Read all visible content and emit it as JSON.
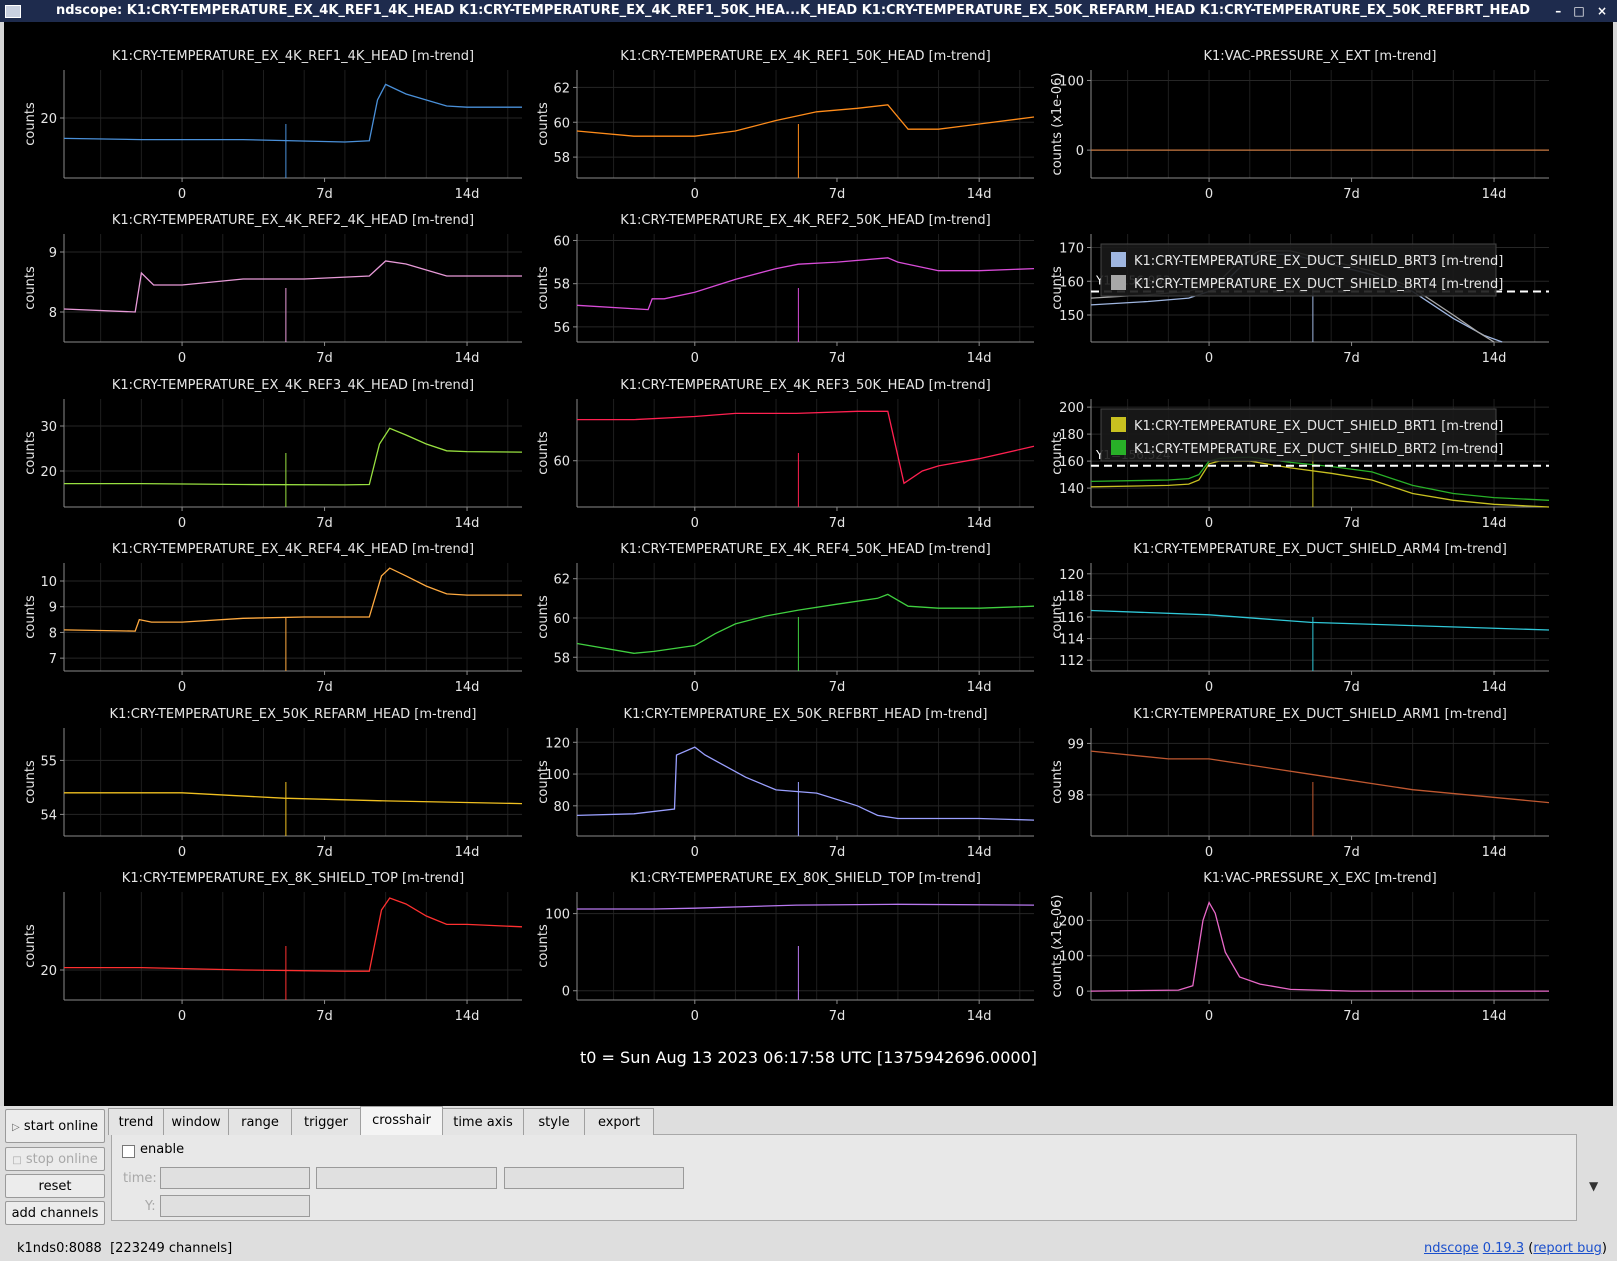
{
  "window": {
    "title": "ndscope: K1:CRY-TEMPERATURE_EX_4K_REF1_4K_HEAD K1:CRY-TEMPERATURE_EX_4K_REF1_50K_HEA...K_HEAD K1:CRY-TEMPERATURE_EX_50K_REFARM_HEAD K1:CRY-TEMPERATURE_EX_50K_REFBRT_HEAD",
    "buttons": "– □ ×"
  },
  "t0_label": "t0 = Sun Aug 13 2023 06:17:58 UTC [1375942696.0000]",
  "chart_data": [
    {
      "type": "line",
      "title": "K1:CRY-TEMPERATURE_EX_4K_REF1_4K_HEAD [m-trend]",
      "ylabel": "counts",
      "color": "#4a90d9",
      "yticks": [
        20
      ],
      "ylim": [
        15,
        24
      ],
      "xticks": [
        0,
        7,
        14
      ],
      "xticklabels": [
        "0",
        "7d",
        "14d"
      ],
      "xlim": [
        -5.8,
        16.7
      ],
      "cursor_x": 5.1,
      "series": [
        {
          "x": [
            -5.8,
            -2,
            3,
            8,
            9.2,
            9.6,
            10,
            11,
            12,
            13,
            14,
            16.7
          ],
          "y": [
            18.3,
            18.2,
            18.2,
            18.0,
            18.1,
            21.5,
            22.8,
            22.0,
            21.5,
            21.0,
            20.9,
            20.9
          ]
        }
      ]
    },
    {
      "type": "line",
      "title": "K1:CRY-TEMPERATURE_EX_4K_REF1_50K_HEAD [m-trend]",
      "ylabel": "counts",
      "color": "#ff8c1a",
      "yticks": [
        58,
        60,
        62
      ],
      "ylim": [
        56.8,
        63
      ],
      "xticks": [
        0,
        7,
        14
      ],
      "xticklabels": [
        "0",
        "7d",
        "14d"
      ],
      "xlim": [
        -5.8,
        16.7
      ],
      "cursor_x": 5.1,
      "series": [
        {
          "x": [
            -5.8,
            -3,
            0,
            2,
            4,
            6,
            8,
            9.5,
            10.5,
            12,
            14,
            16.7
          ],
          "y": [
            59.5,
            59.2,
            59.2,
            59.5,
            60.1,
            60.6,
            60.8,
            61.0,
            59.6,
            59.6,
            59.9,
            60.3
          ]
        }
      ]
    },
    {
      "type": "line",
      "title": "K1:VAC-PRESSURE_X_EXT [m-trend]",
      "ylabel": "counts (x1e-06)",
      "color": "#c87840",
      "yticks": [
        0,
        100
      ],
      "ylim": [
        -40,
        115
      ],
      "xticks": [
        0,
        7,
        14
      ],
      "xticklabels": [
        "0",
        "7d",
        "14d"
      ],
      "xlim": [
        -5.8,
        16.7
      ],
      "cursor_x": null,
      "series": [
        {
          "x": [
            -5.8,
            16.7
          ],
          "y": [
            0,
            0
          ]
        }
      ]
    },
    {
      "type": "line",
      "title": "K1:CRY-TEMPERATURE_EX_4K_REF2_4K_HEAD [m-trend]",
      "ylabel": "counts",
      "color": "#e89ad8",
      "yticks": [
        8,
        9
      ],
      "ylim": [
        7.5,
        9.3
      ],
      "xticks": [
        0,
        7,
        14
      ],
      "xticklabels": [
        "0",
        "7d",
        "14d"
      ],
      "xlim": [
        -5.8,
        16.7
      ],
      "cursor_x": 5.1,
      "series": [
        {
          "x": [
            -5.8,
            -2.3,
            -2.0,
            -1.4,
            0,
            3,
            6,
            9.2,
            10,
            11,
            12,
            13,
            14,
            16.7
          ],
          "y": [
            8.05,
            8.0,
            8.65,
            8.45,
            8.45,
            8.55,
            8.55,
            8.6,
            8.85,
            8.8,
            8.7,
            8.6,
            8.6,
            8.6
          ]
        }
      ]
    },
    {
      "type": "line",
      "title": "K1:CRY-TEMPERATURE_EX_4K_REF2_50K_HEAD [m-trend]",
      "ylabel": "counts",
      "color": "#d84cd8",
      "yticks": [
        56,
        58,
        60
      ],
      "ylim": [
        55.3,
        60.3
      ],
      "xticks": [
        0,
        7,
        14
      ],
      "xticklabels": [
        "0",
        "7d",
        "14d"
      ],
      "xlim": [
        -5.8,
        16.7
      ],
      "cursor_x": 5.1,
      "series": [
        {
          "x": [
            -5.8,
            -2.3,
            -2.1,
            -1.5,
            0,
            2,
            4,
            5.1,
            7,
            9.5,
            10,
            12,
            14,
            16.7
          ],
          "y": [
            57.0,
            56.8,
            57.3,
            57.3,
            57.6,
            58.2,
            58.7,
            58.9,
            59.0,
            59.2,
            59.0,
            58.6,
            58.6,
            58.7
          ]
        }
      ]
    },
    {
      "type": "line",
      "title": "",
      "ylabel": "counts",
      "color": "#9fb6e0",
      "yticks": [
        150,
        160,
        170
      ],
      "ylim": [
        142,
        174
      ],
      "xticks": [
        0,
        7,
        14
      ],
      "xticklabels": [
        "0",
        "7d",
        "14d"
      ],
      "xlim": [
        -5.8,
        16.7
      ],
      "cursor_x": 5.1,
      "hline": 156.953,
      "hline_label": "Y1=156.953",
      "legend_placement": "top",
      "series": [
        {
          "name": "K1:CRY-TEMPERATURE_EX_DUCT_SHIELD_BRT3 [m-trend]",
          "color": "#9fb6e0",
          "x": [
            -5.8,
            -3,
            -1,
            0.5,
            1.5,
            2.5,
            4,
            6,
            8,
            10,
            12,
            13.5,
            14.4
          ],
          "y": [
            153,
            154,
            155,
            158,
            164,
            168,
            168,
            165,
            162,
            157,
            149,
            144,
            142
          ]
        },
        {
          "name": "K1:CRY-TEMPERATURE_EX_DUCT_SHIELD_BRT4 [m-trend]",
          "color": "#a8a8a8",
          "x": [
            -5.8,
            -3,
            -1,
            0.5,
            1.5,
            2.5,
            4,
            6,
            8,
            10,
            12,
            13.2,
            14
          ],
          "y": [
            155,
            156,
            157,
            160,
            166,
            169,
            169,
            166,
            163,
            158,
            150,
            145,
            142
          ]
        }
      ]
    },
    {
      "type": "line",
      "title": "K1:CRY-TEMPERATURE_EX_4K_REF3_4K_HEAD [m-trend]",
      "ylabel": "counts",
      "color": "#98e040",
      "yticks": [
        20,
        30
      ],
      "ylim": [
        12,
        36
      ],
      "xticks": [
        0,
        7,
        14
      ],
      "xticklabels": [
        "0",
        "7d",
        "14d"
      ],
      "xlim": [
        -5.8,
        16.7
      ],
      "cursor_x": 5.1,
      "series": [
        {
          "x": [
            -5.8,
            -2,
            3,
            8,
            9.2,
            9.7,
            10.2,
            11,
            12,
            13,
            14,
            16.7
          ],
          "y": [
            17.2,
            17.2,
            17.0,
            16.9,
            17.0,
            26.0,
            29.5,
            28.0,
            26.0,
            24.5,
            24.3,
            24.2
          ]
        }
      ]
    },
    {
      "type": "line",
      "title": "K1:CRY-TEMPERATURE_EX_4K_REF3_50K_HEAD [m-trend]",
      "ylabel": "counts",
      "color": "#ff2050",
      "yticks": [
        60
      ],
      "ylim": [
        55.5,
        66
      ],
      "xticks": [
        0,
        7,
        14
      ],
      "xticklabels": [
        "0",
        "7d",
        "14d"
      ],
      "xlim": [
        -5.8,
        16.7
      ],
      "cursor_x": 5.1,
      "series": [
        {
          "x": [
            -5.8,
            -3,
            0,
            2,
            5,
            8,
            9.5,
            10.3,
            11.2,
            12,
            14,
            16.7
          ],
          "y": [
            64.0,
            64.0,
            64.3,
            64.6,
            64.6,
            64.8,
            64.8,
            57.8,
            59.0,
            59.5,
            60.2,
            61.4
          ]
        }
      ]
    },
    {
      "type": "line",
      "title": "",
      "ylabel": "counts",
      "color": "#c8c020",
      "yticks": [
        140,
        160,
        180,
        200
      ],
      "ylim": [
        126,
        206
      ],
      "xticks": [
        0,
        7,
        14
      ],
      "xticklabels": [
        "0",
        "7d",
        "14d"
      ],
      "xlim": [
        -5.8,
        16.7
      ],
      "cursor_x": 5.1,
      "hline": 156.524,
      "hline_label": "Y1=156.524",
      "legend_placement": "top",
      "series": [
        {
          "name": "K1:CRY-TEMPERATURE_EX_DUCT_SHIELD_BRT1 [m-trend]",
          "color": "#c8c020",
          "x": [
            -5.8,
            -2,
            -1,
            -0.5,
            0,
            0.5,
            2,
            4,
            6,
            8,
            10,
            12,
            14,
            16.7
          ],
          "y": [
            141,
            142,
            143,
            146,
            158,
            160,
            160,
            155,
            151,
            146,
            136,
            131,
            128,
            126
          ]
        },
        {
          "name": "K1:CRY-TEMPERATURE_EX_DUCT_SHIELD_BRT2 [m-trend]",
          "color": "#28b028",
          "x": [
            -5.8,
            -2,
            -1,
            -0.5,
            0,
            0.5,
            2,
            4,
            6,
            8,
            10,
            12,
            14,
            16.7
          ],
          "y": [
            145,
            146,
            147,
            150,
            160,
            162,
            163,
            159,
            156,
            152,
            142,
            136,
            133,
            131
          ]
        }
      ]
    },
    {
      "type": "line",
      "title": "K1:CRY-TEMPERATURE_EX_4K_REF4_4K_HEAD [m-trend]",
      "ylabel": "counts",
      "color": "#ffaa40",
      "yticks": [
        7,
        8,
        9,
        10
      ],
      "ylim": [
        6.5,
        10.7
      ],
      "xticks": [
        0,
        7,
        14
      ],
      "xticklabels": [
        "0",
        "7d",
        "14d"
      ],
      "xlim": [
        -5.8,
        16.7
      ],
      "cursor_x": 5.1,
      "series": [
        {
          "x": [
            -5.8,
            -2.3,
            -2.1,
            -1.5,
            0,
            3,
            6,
            9.2,
            9.8,
            10.2,
            11,
            12,
            13,
            14,
            16.7
          ],
          "y": [
            8.1,
            8.05,
            8.5,
            8.4,
            8.4,
            8.55,
            8.6,
            8.6,
            10.2,
            10.5,
            10.2,
            9.8,
            9.5,
            9.45,
            9.45
          ]
        }
      ]
    },
    {
      "type": "line",
      "title": "K1:CRY-TEMPERATURE_EX_4K_REF4_50K_HEAD [m-trend]",
      "ylabel": "counts",
      "color": "#40d040",
      "yticks": [
        58,
        60,
        62
      ],
      "ylim": [
        57.3,
        62.8
      ],
      "xticks": [
        0,
        7,
        14
      ],
      "xticklabels": [
        "0",
        "7d",
        "14d"
      ],
      "xlim": [
        -5.8,
        16.7
      ],
      "cursor_x": 5.1,
      "series": [
        {
          "x": [
            -5.8,
            -3,
            -2,
            0,
            1,
            2,
            3.5,
            5.1,
            7,
            9,
            9.5,
            10.5,
            12,
            14,
            16.7
          ],
          "y": [
            58.7,
            58.2,
            58.3,
            58.6,
            59.2,
            59.7,
            60.1,
            60.4,
            60.7,
            61.0,
            61.2,
            60.6,
            60.5,
            60.5,
            60.6
          ]
        }
      ]
    },
    {
      "type": "line",
      "title": "K1:CRY-TEMPERATURE_EX_DUCT_SHIELD_ARM4 [m-trend]",
      "ylabel": "counts",
      "color": "#30c8d8",
      "yticks": [
        112,
        114,
        116,
        118,
        120
      ],
      "ylim": [
        111,
        121
      ],
      "xticks": [
        0,
        7,
        14
      ],
      "xticklabels": [
        "0",
        "7d",
        "14d"
      ],
      "xlim": [
        -5.8,
        16.7
      ],
      "cursor_x": 5.1,
      "series": [
        {
          "x": [
            -5.8,
            0,
            5,
            10,
            16.7
          ],
          "y": [
            116.6,
            116.2,
            115.5,
            115.2,
            114.8
          ]
        }
      ]
    },
    {
      "type": "line",
      "title": "K1:CRY-TEMPERATURE_EX_50K_REFARM_HEAD [m-trend]",
      "ylabel": "counts",
      "color": "#f0c020",
      "yticks": [
        54,
        55
      ],
      "ylim": [
        53.6,
        55.6
      ],
      "xticks": [
        0,
        7,
        14
      ],
      "xticklabels": [
        "0",
        "7d",
        "14d"
      ],
      "xlim": [
        -5.8,
        16.7
      ],
      "cursor_x": 5.1,
      "series": [
        {
          "x": [
            -5.8,
            0,
            5,
            10,
            16.7
          ],
          "y": [
            54.4,
            54.4,
            54.3,
            54.25,
            54.2
          ]
        }
      ]
    },
    {
      "type": "line",
      "title": "K1:CRY-TEMPERATURE_EX_50K_REFBRT_HEAD [m-trend]",
      "ylabel": "counts",
      "color": "#9aa0ff",
      "yticks": [
        80,
        100,
        120
      ],
      "ylim": [
        61,
        129
      ],
      "xticks": [
        0,
        7,
        14
      ],
      "xticklabels": [
        "0",
        "7d",
        "14d"
      ],
      "xlim": [
        -5.8,
        16.7
      ],
      "cursor_x": 5.1,
      "series": [
        {
          "x": [
            -5.8,
            -3,
            -1,
            -0.9,
            0,
            0.5,
            1.5,
            2.5,
            4,
            6,
            8,
            9,
            10,
            12,
            14,
            16.7
          ],
          "y": [
            74,
            75,
            78,
            112,
            117,
            112,
            105,
            98,
            90,
            88,
            80,
            74,
            72,
            72,
            72,
            71
          ]
        }
      ]
    },
    {
      "type": "line",
      "title": "K1:CRY-TEMPERATURE_EX_DUCT_SHIELD_ARM1 [m-trend]",
      "ylabel": "counts",
      "color": "#c05830",
      "yticks": [
        98,
        99
      ],
      "ylim": [
        97.2,
        99.3
      ],
      "xticks": [
        0,
        7,
        14
      ],
      "xticklabels": [
        "0",
        "7d",
        "14d"
      ],
      "xlim": [
        -5.8,
        16.7
      ],
      "cursor_x": 5.1,
      "series": [
        {
          "x": [
            -5.8,
            -2,
            0,
            5,
            10,
            16.7
          ],
          "y": [
            98.85,
            98.7,
            98.7,
            98.4,
            98.1,
            97.85
          ]
        }
      ]
    },
    {
      "type": "line",
      "title": "K1:CRY-TEMPERATURE_EX_8K_SHIELD_TOP [m-trend]",
      "ylabel": "counts",
      "color": "#ff3030",
      "yticks": [
        20
      ],
      "ylim": [
        17.5,
        26.5
      ],
      "xticks": [
        0,
        7,
        14
      ],
      "xticklabels": [
        "0",
        "7d",
        "14d"
      ],
      "xlim": [
        -5.8,
        16.7
      ],
      "cursor_x": 5.1,
      "series": [
        {
          "x": [
            -5.8,
            -2,
            3,
            8,
            9.2,
            9.8,
            10.2,
            11,
            12,
            13,
            14,
            16.7
          ],
          "y": [
            20.2,
            20.2,
            20.0,
            19.9,
            19.9,
            25.0,
            26.0,
            25.5,
            24.5,
            23.8,
            23.8,
            23.6
          ]
        }
      ]
    },
    {
      "type": "line",
      "title": "K1:CRY-TEMPERATURE_EX_80K_SHIELD_TOP [m-trend]",
      "ylabel": "counts",
      "color": "#b878f0",
      "yticks": [
        0,
        100
      ],
      "ylim": [
        -12,
        128
      ],
      "xticks": [
        0,
        7,
        14
      ],
      "xticklabels": [
        "0",
        "7d",
        "14d"
      ],
      "xlim": [
        -5.8,
        16.7
      ],
      "cursor_x": 5.1,
      "series": [
        {
          "x": [
            -5.8,
            -2,
            0,
            5,
            10,
            16.7
          ],
          "y": [
            106,
            106,
            107,
            111,
            112,
            111
          ]
        }
      ]
    },
    {
      "type": "line",
      "title": "K1:VAC-PRESSURE_X_EXC [m-trend]",
      "ylabel": "counts (x1e-06)",
      "color": "#e868c8",
      "yticks": [
        0,
        100,
        200
      ],
      "ylim": [
        -25,
        280
      ],
      "xticks": [
        0,
        7,
        14
      ],
      "xticklabels": [
        "0",
        "7d",
        "14d"
      ],
      "xlim": [
        -5.8,
        16.7
      ],
      "cursor_x": null,
      "series": [
        {
          "x": [
            -5.8,
            -1.5,
            -0.8,
            -0.3,
            0,
            0.3,
            0.8,
            1.5,
            2.5,
            4,
            7,
            16.7
          ],
          "y": [
            0,
            3,
            15,
            200,
            250,
            220,
            110,
            40,
            20,
            5,
            0,
            0
          ]
        }
      ]
    }
  ],
  "sidebar": {
    "start_online": "start online",
    "stop_online": "stop online",
    "reset": "reset",
    "add_channels": "add channels"
  },
  "tabs": [
    "trend",
    "window",
    "range",
    "trigger",
    "crosshair",
    "time axis",
    "style",
    "export"
  ],
  "crosshair": {
    "enable_label": "enable",
    "time_label": "time:",
    "y_label": "Y:"
  },
  "status": {
    "server": "k1nds0:8088",
    "channels": "[223249 channels]",
    "app": "ndscope",
    "version": "0.19.3",
    "report_bug": "report bug"
  }
}
